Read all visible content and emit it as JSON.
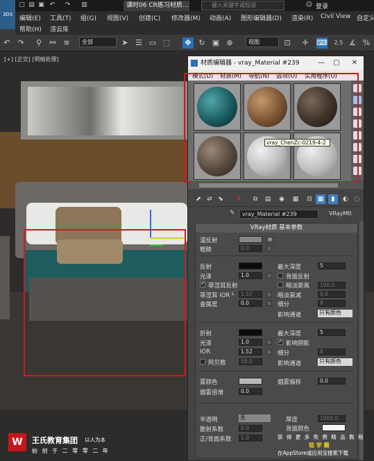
{
  "window": {
    "doc_tab": "课时06 CR练习材质…",
    "search_placeholder": "键入关键字或短语",
    "login": "登录"
  },
  "menubar": {
    "items_row1": [
      "编辑(E)",
      "工具(T)",
      "组(G)",
      "视图(V)",
      "创建(C)",
      "修改器(M)",
      "动画(A)",
      "图形编辑器(D)",
      "渲染(R)",
      "Civil View",
      "自定义"
    ],
    "items_row2": [
      "帮助(H)",
      "渲云库"
    ]
  },
  "toolbar": {
    "selection_filter": "全部",
    "ref_coord": "视图",
    "snap_value": "2.5"
  },
  "viewport": {
    "label": "[+] [正交] [明暗处理]"
  },
  "material_editor": {
    "title": "材质编辑器 - vray_Material #239",
    "menus": [
      "模式(D)",
      "材质(M)",
      "导航(N)",
      "选项(O)",
      "实用程序(U)"
    ],
    "slot_tooltip": "vray_ChenZc-0219-4-2",
    "material_name": "vray_Material #239",
    "material_type": "VRayMtl",
    "rollout_title": "VRay材质 基本参数",
    "diffuse": {
      "label": "漫反射",
      "map_btn": "M"
    },
    "roughness": {
      "label": "粗糙",
      "value": "0.0"
    },
    "reflect": {
      "label": "反射",
      "color": "#0b0b0b"
    },
    "gloss": {
      "label": "光泽",
      "value": "1.0"
    },
    "fresnel": {
      "label": "菲涅耳反射",
      "checked": true
    },
    "fresnel_ior": {
      "label": "菲涅耳 IOR",
      "lock": "L",
      "value": "1.52"
    },
    "metalness": {
      "label": "金属度",
      "value": "0.0"
    },
    "max_depth": {
      "label": "最大深度",
      "value": "5"
    },
    "back_reflect": {
      "label": "背面反射",
      "checked": false
    },
    "dim_distance": {
      "label": "暗淡距离",
      "checked": false,
      "value": "100.0"
    },
    "dim_falloff": {
      "label": "暗淡衰减",
      "value": "0.0"
    },
    "subdivs": {
      "label": "细分",
      "value": "8"
    },
    "affect_channels": {
      "label": "影响通道",
      "value": "只有颜色"
    },
    "refract": {
      "label": "折射",
      "color": "#0b0b0b"
    },
    "refr_gloss": {
      "label": "光泽",
      "value": "1.0"
    },
    "ior": {
      "label": "IOR",
      "value": "1.52"
    },
    "abbe": {
      "label": "阿贝数",
      "checked": false,
      "value": "50.0"
    },
    "refr_max_depth": {
      "label": "最大深度",
      "value": "5"
    },
    "affect_shadows": {
      "label": "影响阴影",
      "checked": true
    },
    "refr_subdivs": {
      "label": "细分",
      "value": "8"
    },
    "refr_affect_channels": {
      "label": "影响通道",
      "value": "只有颜色"
    },
    "fog_color": {
      "label": "雾颜色",
      "color": "#b8b8b8"
    },
    "fog_bias": {
      "label": "烟雾偏移",
      "value": "0.0"
    },
    "fog_mult": {
      "label": "烟雾倍增",
      "value": "0.0"
    },
    "translucency": {
      "label": "半透明",
      "value": "无"
    },
    "scatter_coef": {
      "label": "散射系数",
      "value": "0.0"
    },
    "fwd_back_coef": {
      "label": "正/背面系数",
      "value": "1.0"
    },
    "thickness": {
      "label": "厚度",
      "value": "1000.0"
    },
    "back_color": {
      "label": "背面颜色",
      "color": "#f5f5f5"
    }
  },
  "watermark": {
    "logo_char": "W",
    "company": "王氏教育集团",
    "slogan": "以人为本",
    "sub": "始 创 于 二 零 零 二 年",
    "right1": "获 得 更 多 免 费 精 品 教 程",
    "right2": "铭 学 霸",
    "right3": "在AppStore或应用宝搜索下载"
  },
  "colors": {
    "accent": "#2b70b5",
    "highlight_red": "#d4161c"
  }
}
